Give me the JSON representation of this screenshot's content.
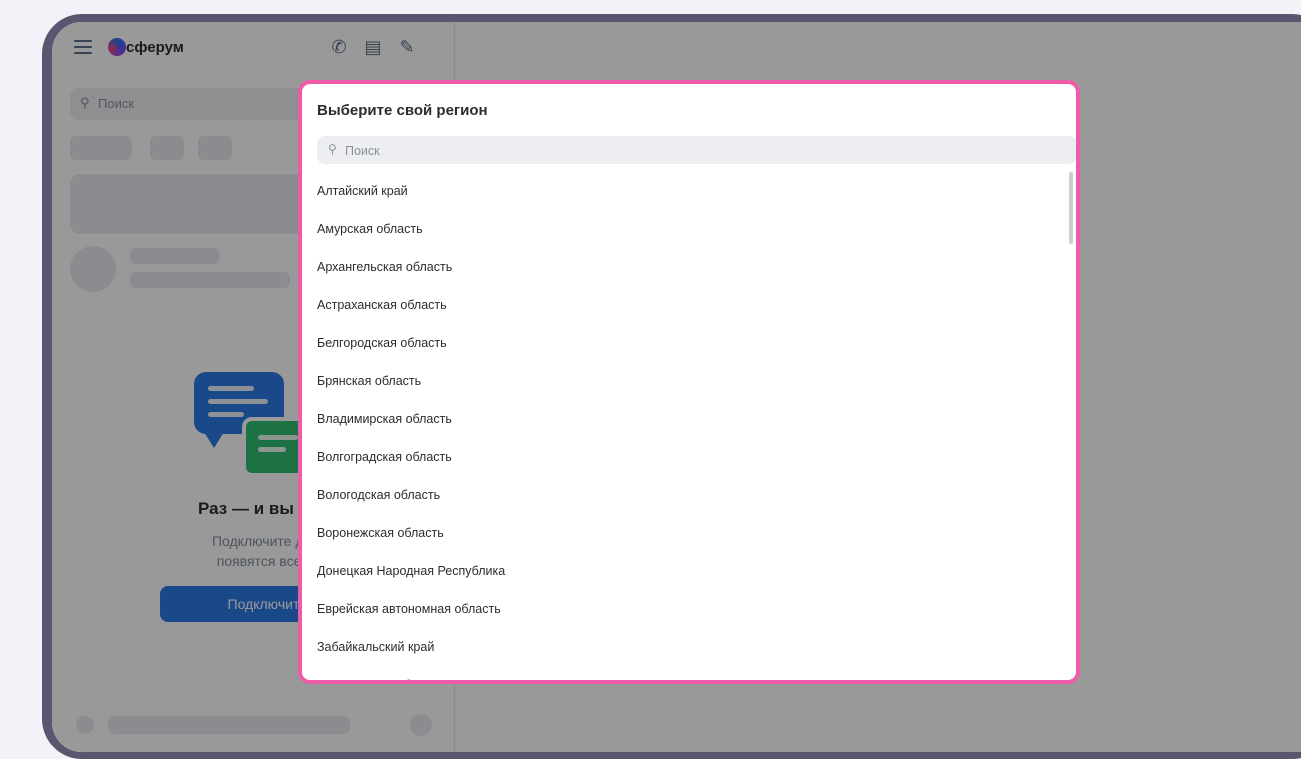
{
  "app": {
    "logo_text": "сферум",
    "accent_color": "#2c7be5",
    "highlight_color": "#ee5ba8"
  },
  "sidebar": {
    "search_placeholder": "Поиск",
    "toolbar_icons": [
      "phone-add-icon",
      "archive-icon",
      "compose-icon"
    ],
    "empty_state": {
      "title": "Раз — и вы в нужн",
      "description_line1": "Подключите дневни",
      "description_line2": "появятся все нужн",
      "button_label": "Подключить дн"
    }
  },
  "modal": {
    "title": "Выберите свой регион",
    "search_placeholder": "Поиск",
    "regions": [
      "Алтайский край",
      "Амурская область",
      "Архангельская область",
      "Астраханская область",
      "Белгородская область",
      "Брянская область",
      "Владимирская область",
      "Волгоградская область",
      "Вологодская область",
      "Воронежская область",
      "Донецкая Народная Республика",
      "Еврейская автономная область",
      "Забайкальский край",
      "Запорожская область"
    ]
  }
}
